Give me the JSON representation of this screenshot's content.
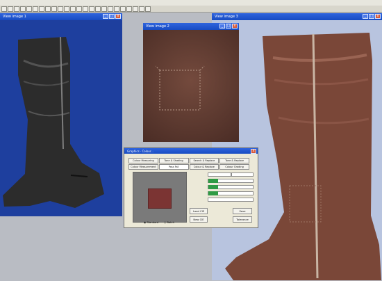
{
  "menu": [],
  "windows": {
    "left": {
      "title": "View image 1"
    },
    "center": {
      "title": "View image 2"
    },
    "right": {
      "title": "View image 3"
    },
    "dialog": {
      "title": "Graphics · Colour...",
      "tabs_row1": [
        "Colour Measuring",
        "Tone & Shading",
        "Search & Replace",
        "Tone & Replace"
      ],
      "tabs_row2": [
        "Colour Measurement",
        "Pass Fail",
        "Colour & Replace",
        "Colour Grading"
      ],
      "buttons": {
        "load": "Load CIE",
        "new": "New CIE",
        "save": "Save",
        "tolerance": "Tolerance"
      },
      "radios": {
        "standard": "Standard",
        "batch": "Batch"
      },
      "options": [],
      "fields": []
    }
  },
  "colors": {
    "accent": "#1f55d2",
    "leather": "#6d4639"
  }
}
